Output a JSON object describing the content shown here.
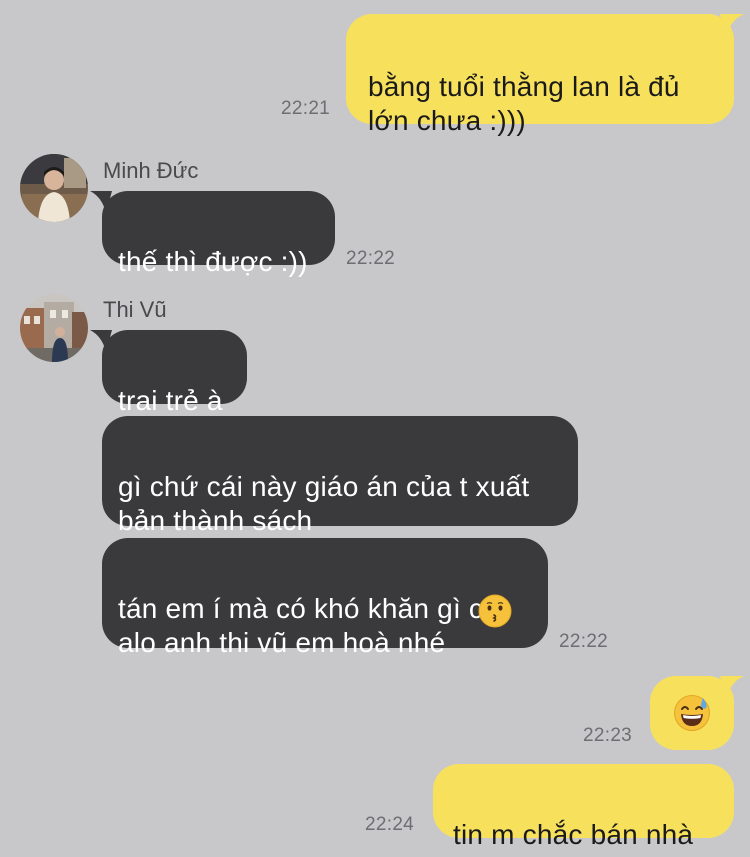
{
  "theme": {
    "background": "#c8c8ca",
    "outgoing_bubble": "#f7e15c",
    "incoming_bubble": "#3a3a3c",
    "timestamp_color": "#6e6e72"
  },
  "messages": [
    {
      "direction": "out",
      "text": "bằng tuổi thằng lan là đủ\nlớn chưa :)))",
      "time": "22:21"
    },
    {
      "direction": "in",
      "sender": "Minh Đức",
      "avatar_icon": "person-photo-icon",
      "text": "thế thì được :))",
      "time": "22:22"
    },
    {
      "direction": "in",
      "sender": "Thi Vũ",
      "avatar_icon": "street-photo-icon",
      "text": "trai trẻ à",
      "time": ""
    },
    {
      "direction": "in",
      "text": "gì chứ cái này giáo án của t xuất\nbản thành sách",
      "time": ""
    },
    {
      "direction": "in",
      "text": "tán em í mà có khó khăn gì cứ\nalo anh thi vũ em hoà nhé",
      "emoji": "kissing-face-icon",
      "time": "22:22"
    },
    {
      "direction": "out",
      "emoji": "grinning-sweat-face-icon",
      "text": "",
      "time": "22:23"
    },
    {
      "direction": "out",
      "text": "tin m chắc bán nhà",
      "time": "22:24"
    }
  ]
}
